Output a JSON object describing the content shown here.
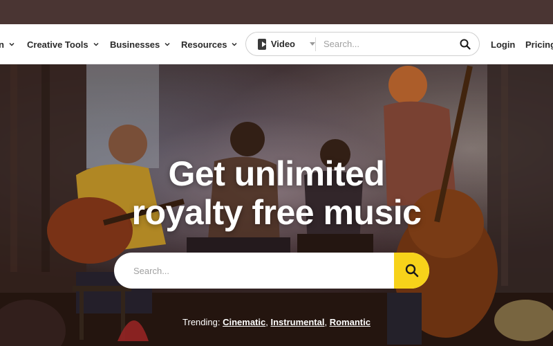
{
  "nav": {
    "cut_item_label": "n",
    "items": [
      {
        "label": "Creative Tools"
      },
      {
        "label": "Businesses"
      },
      {
        "label": "Resources"
      }
    ],
    "login": "Login",
    "pricing": "Pricing"
  },
  "search": {
    "type": "Video",
    "placeholder": "Search..."
  },
  "hero": {
    "title_line1": "Get unlimited",
    "title_line2": "royalty free music",
    "search_placeholder": "Search...",
    "trending_label": "Trending:",
    "trending": [
      "Cinematic",
      "Instrumental",
      "Romantic"
    ]
  },
  "colors": {
    "topbar": "#4a3533",
    "accent": "#f7d21a"
  },
  "icons": {
    "nav_chevron": "chevron-down-icon",
    "video": "play-icon",
    "search": "search-icon"
  }
}
